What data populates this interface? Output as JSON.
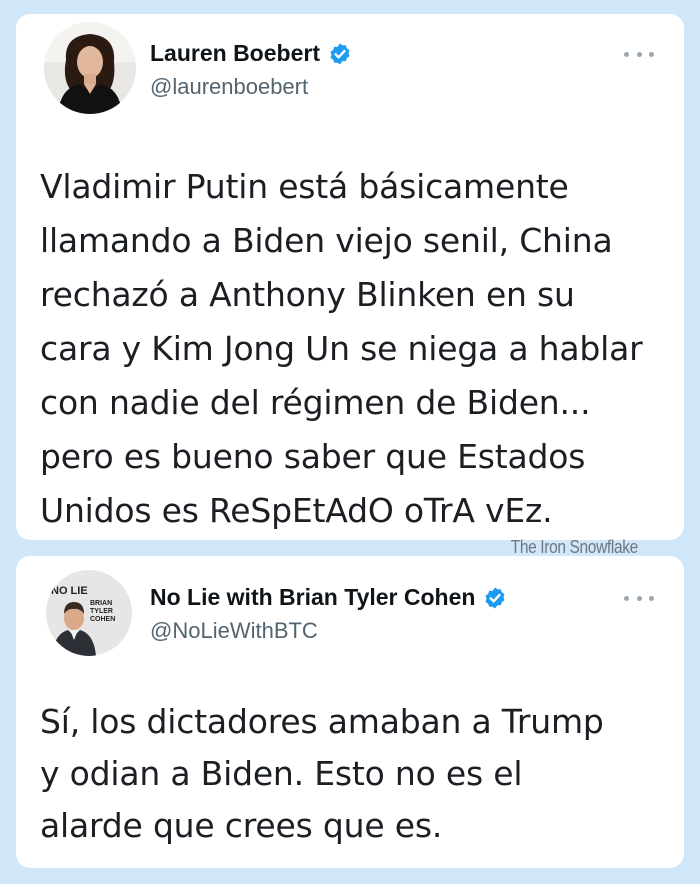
{
  "tweets": [
    {
      "display_name": "Lauren Boebert",
      "handle": "@laurenboebert",
      "text": "Vladimir Putin está básicamente\nllamando a Biden viejo senil, China\nrechazó a Anthony Blinken en su\ncara y Kim Jong Un se niega a hablar\ncon nadie del régimen de Biden...\npero es bueno saber que Estados\nUnidos es ReSpEtAdO oTrA vEz."
    },
    {
      "display_name": "No Lie with Brian Tyler Cohen",
      "handle": "@NoLieWithBTC",
      "avatar_logo": [
        "NO LIE",
        "BRIAN",
        "TYLER",
        "COHEN"
      ],
      "text": "Sí, los dictadores amaban a Trump\ny odian a Biden. Esto no es el\nalarde que crees que es."
    }
  ],
  "watermark": "The Iron Snowflake",
  "icons": {
    "verified": "verified-badge-icon",
    "more": "more-options-icon"
  },
  "colors": {
    "background": "#cfe7f8",
    "card": "#ffffff",
    "verified": "#1d9bf0",
    "handle": "#536471",
    "text": "#1b1f24"
  }
}
